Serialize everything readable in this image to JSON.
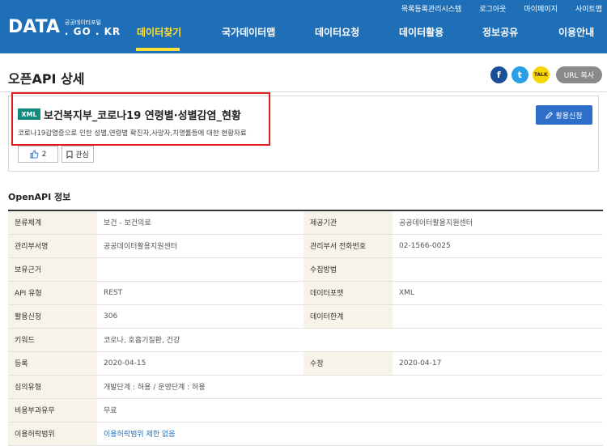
{
  "header": {
    "logo_main": "DATA",
    "logo_sub1": "공공데이터포털",
    "logo_sub2": ". GO . KR",
    "util_links": [
      "목록등록관리시스템",
      "로그아웃",
      "마이페이지",
      "사이트맵"
    ],
    "nav": [
      "데이터찾기",
      "국가데이터맵",
      "데이터요청",
      "데이터활용",
      "정보공유",
      "이용안내"
    ],
    "active_nav": "데이터찾기",
    "brand_color": "#1f6fb8",
    "active_color": "#ffe13a"
  },
  "page": {
    "title": "오픈API 상세",
    "share": {
      "facebook_icon": "f",
      "twitter_icon": "t",
      "kakao_icon": "TALK",
      "url_copy_label": "URL 복사"
    }
  },
  "dataset": {
    "format_tag": "XML",
    "title": "보건복지부_코로나19 연령별·성별감염_현황",
    "description": "코로나19감염증으로 인한 성별,연령별 확진자,사망자,치명률등에 대한 현황자료",
    "apply_label": "활용신청",
    "like_count": "2",
    "interest_label": "관심"
  },
  "info": {
    "section_title": "OpenAPI 정보",
    "rows": [
      {
        "l1": "분류체계",
        "v1": "보건 - 보건의료",
        "l2": "제공기관",
        "v2": "공공데이터활용지원센터"
      },
      {
        "l1": "관리부서명",
        "v1": "공공데이터활용지원센터",
        "l2": "관리부서 전화번호",
        "v2": "02-1566-0025"
      },
      {
        "l1": "보유근거",
        "v1": "",
        "l2": "수집방법",
        "v2": ""
      },
      {
        "l1": "API 유형",
        "v1": "REST",
        "l2": "데이터포맷",
        "v2": "XML"
      },
      {
        "l1": "활용신청",
        "v1": "306",
        "l2": "데이터한계",
        "v2": ""
      },
      {
        "l1": "키워드",
        "v1": "코로나, 호흡기질환, 건강"
      },
      {
        "l1": "등록",
        "v1": "2020-04-15",
        "l2": "수정",
        "v2": "2020-04-17"
      },
      {
        "l1": "심의유형",
        "v1": "개발단계 : 허용 / 운영단계 : 허용"
      },
      {
        "l1": "비용부과유무",
        "v1": "무료"
      },
      {
        "l1": "이용허락범위",
        "v1": "이용허락범위 제한 없음"
      }
    ]
  }
}
